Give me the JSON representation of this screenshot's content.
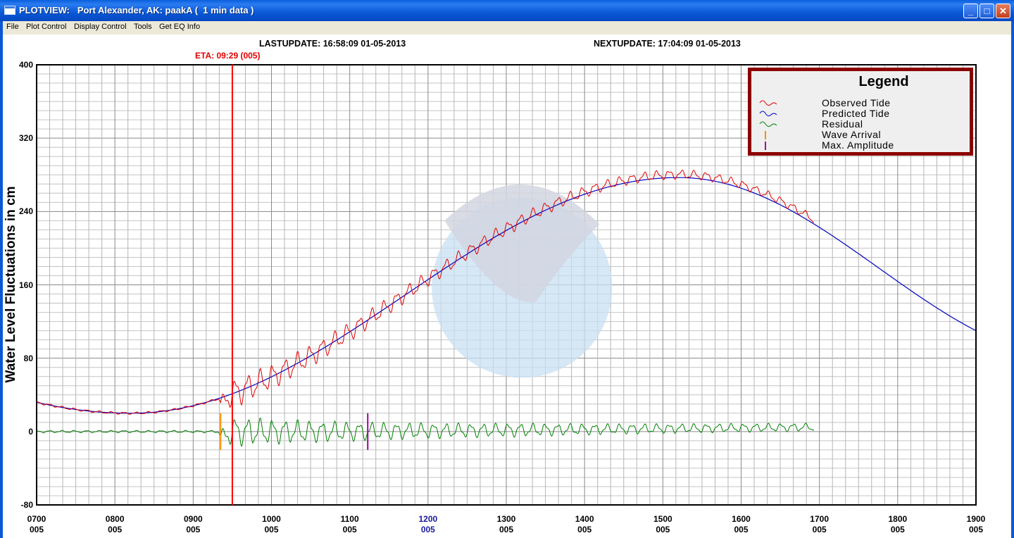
{
  "window": {
    "title": "PLOTVIEW:   Port Alexander, AK: paakA (  1 min data )",
    "minimize": "_",
    "maximize": "□",
    "close": "✕"
  },
  "menu": [
    "File",
    "Plot Control",
    "Display Control",
    "Tools",
    "Get EQ Info"
  ],
  "header": {
    "last_update": "LASTUPDATE: 16:58:09 01-05-2013",
    "next_update": "NEXTUPDATE: 17:04:09 01-05-2013",
    "eta": "ETA: 09:29 (005)"
  },
  "colors": {
    "observed": "#e00000",
    "predicted": "#0000c0",
    "residual": "#008000",
    "wave_arrival": "#ff8c00",
    "max_amplitude": "#a000a0",
    "eta_line": "#ff0000",
    "legend_border": "#8b0000"
  },
  "legend": {
    "title": "Legend",
    "items": [
      {
        "label": "Observed Tide",
        "color": "#e00000",
        "symbol": "wave"
      },
      {
        "label": "Predicted Tide",
        "color": "#0000c0",
        "symbol": "wave"
      },
      {
        "label": "Residual",
        "color": "#008000",
        "symbol": "wave"
      },
      {
        "label": "Wave Arrival",
        "color": "#ff8c00",
        "symbol": "bar"
      },
      {
        "label": "Max. Amplitude",
        "color": "#a000a0",
        "symbol": "bar"
      }
    ]
  },
  "chart_data": {
    "type": "line",
    "ylabel": "Water Level Fluctuations in cm",
    "ylim": [
      -80,
      400
    ],
    "yticks": [
      "400",
      "320",
      "240",
      "160",
      "80",
      "0",
      "-80"
    ],
    "xlim": [
      700,
      1900
    ],
    "xticks": [
      {
        "time": "0700",
        "day": "005"
      },
      {
        "time": "0800",
        "day": "005"
      },
      {
        "time": "0900",
        "day": "005"
      },
      {
        "time": "1000",
        "day": "005"
      },
      {
        "time": "1100",
        "day": "005"
      },
      {
        "time": "1200",
        "day": "005",
        "highlight": true
      },
      {
        "time": "1300",
        "day": "005"
      },
      {
        "time": "1400",
        "day": "005"
      },
      {
        "time": "1500",
        "day": "005"
      },
      {
        "time": "1600",
        "day": "005"
      },
      {
        "time": "1700",
        "day": "005"
      },
      {
        "time": "1800",
        "day": "005"
      },
      {
        "time": "1900",
        "day": "005"
      }
    ],
    "grid": true,
    "eta_hours": 9.5,
    "wave_arrival_hours": 9.35,
    "max_amplitude_hours": 11.23,
    "predicted_tide": {
      "min": {
        "hours": 8.2,
        "value": 20
      },
      "max": {
        "hours": 15.2,
        "value": 277
      },
      "end": {
        "hours": 19.0,
        "value": 110
      }
    },
    "observed_end_hours": 16.93,
    "series": [
      {
        "name": "Observed Tide",
        "values_desc": "predicted tide plus residual"
      },
      {
        "name": "Predicted Tide"
      },
      {
        "name": "Residual",
        "start_hours": 7.0,
        "end_hours": 16.93
      }
    ]
  }
}
